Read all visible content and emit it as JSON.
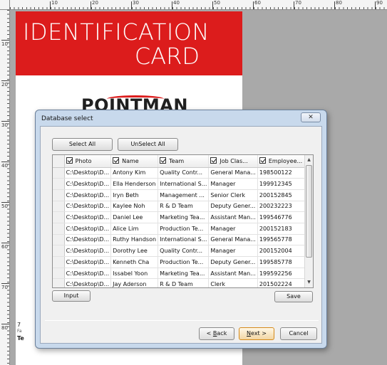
{
  "ruler": {
    "top_labels": [
      "10",
      "20",
      "30",
      "40",
      "50",
      "60",
      "70",
      "80",
      "90"
    ],
    "left_labels": [
      "10",
      "20",
      "30",
      "40",
      "50",
      "60",
      "70",
      "80"
    ]
  },
  "card": {
    "title_line1": "IDENTIFICATION",
    "title_line2": "CARD",
    "logo": "POINTMAN",
    "side_line1": "7",
    "side_line2": "Fa",
    "side_line3": "Te",
    "banner_color": "#dc1c1c"
  },
  "dialog": {
    "title": "Database select",
    "close_label": "✕",
    "select_all_label": "Select All",
    "unselect_all_label": "UnSelect All",
    "input_label": "Input",
    "save_label": "Save",
    "back_label_prefix": "< ",
    "back_label_key": "B",
    "back_label_rest": "ack",
    "next_label_key": "N",
    "next_label_rest": "ext >",
    "cancel_label": "Cancel",
    "columns": [
      "Photo",
      "Name",
      "Team",
      "Job Clas...",
      "Employee..."
    ],
    "rows": [
      [
        "C:\\Desktop\\D...",
        "Antony Kim",
        "Quality Contr...",
        "General Mana...",
        "198500122"
      ],
      [
        "C:\\Desktop\\D...",
        "Ella Henderson",
        "International S...",
        "Manager",
        "199912345"
      ],
      [
        "C:\\Desktop\\D...",
        "Iryn Beth",
        "Management ...",
        "Senior Clerk",
        "200152845"
      ],
      [
        "C:\\Desktop\\D...",
        "Kaylee Noh",
        "R & D Team",
        "Deputy Gener...",
        "200232223"
      ],
      [
        "C:\\Desktop\\D...",
        "Daniel Lee",
        "Marketing Tea...",
        "Assistant Man...",
        "199546776"
      ],
      [
        "C:\\Desktop\\D...",
        "Alice Lim",
        "Production Te...",
        "Manager",
        "200152183"
      ],
      [
        "C:\\Desktop\\D...",
        "Ruthy Handson",
        "International S...",
        "General Mana...",
        "199565778"
      ],
      [
        "C:\\Desktop\\D...",
        "Dorothy Lee",
        "Quality Contr...",
        "Manager",
        "200152004"
      ],
      [
        "C:\\Desktop\\D...",
        "Kenneth Cha",
        "Production Te...",
        "Deputy Gener...",
        "199585778"
      ],
      [
        "C:\\Desktop\\D...",
        "Issabel Yoon",
        "Marketing Tea...",
        "Assistant Man...",
        "199592256"
      ],
      [
        "C:\\Desktop\\D...",
        "Jay Aderson",
        "R & D Team",
        "Clerk",
        "201502224"
      ]
    ]
  }
}
